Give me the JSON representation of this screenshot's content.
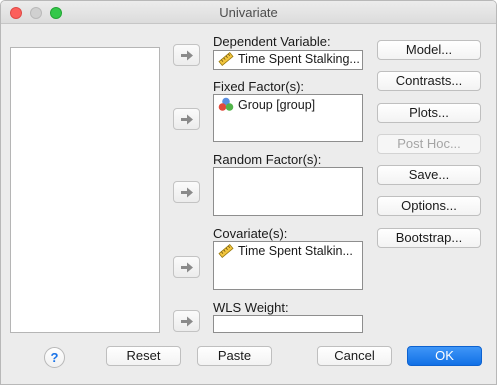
{
  "window": {
    "title": "Univariate"
  },
  "fields": {
    "dependent": {
      "label": "Dependent Variable:",
      "value": "Time Spent Stalking..."
    },
    "fixed": {
      "label": "Fixed Factor(s):",
      "items": [
        "Group [group]"
      ]
    },
    "random": {
      "label": "Random Factor(s):"
    },
    "covariate": {
      "label": "Covariate(s):",
      "items": [
        "Time Spent Stalkin..."
      ]
    },
    "wls": {
      "label": "WLS Weight:"
    }
  },
  "side_buttons": {
    "model": "Model...",
    "contrasts": "Contrasts...",
    "plots": "Plots...",
    "posthoc": "Post Hoc...",
    "save": "Save...",
    "options": "Options...",
    "bootstrap": "Bootstrap..."
  },
  "bottom_buttons": {
    "help": "?",
    "reset": "Reset",
    "paste": "Paste",
    "cancel": "Cancel",
    "ok": "OK"
  },
  "icons": {
    "scale_variable": "ruler-icon",
    "nominal_variable": "nominal-circles-icon",
    "move_arrow": "arrow-right-icon"
  },
  "colors": {
    "ok_button": "#1170e6",
    "close_light": "#fc605c",
    "zoom_light": "#34c84a"
  }
}
